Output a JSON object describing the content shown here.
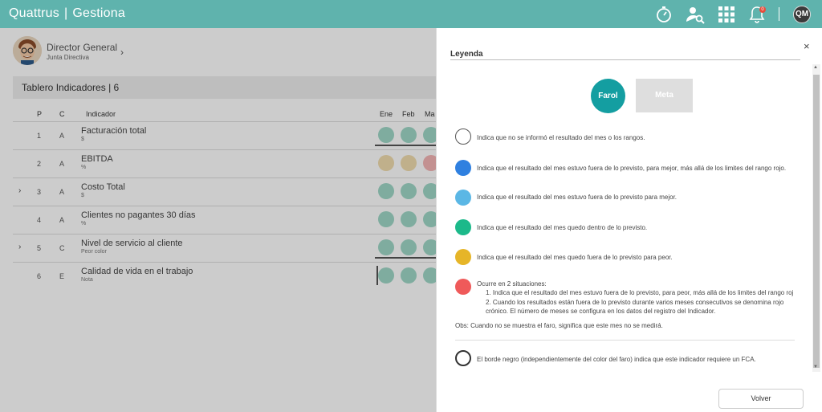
{
  "app": {
    "brand_left": "Quattrus",
    "brand_sep": "|",
    "brand_right": "Gestiona",
    "user_initials": "QM",
    "notification_count": "0"
  },
  "profile": {
    "title": "Director General",
    "subtitle": "Junta Directiva"
  },
  "tablero": {
    "title": "Tablero Indicadores | 6"
  },
  "table": {
    "headers": {
      "p": "P",
      "c": "C",
      "indicador": "Indicador",
      "m1": "Ene",
      "m2": "Feb",
      "m3": "Ma"
    },
    "rows": [
      {
        "p": "1",
        "c": "A",
        "name": "Facturación total",
        "unit": "$",
        "colors": [
          "#9fd8c7",
          "#9fd8c7",
          "#9fd8c7"
        ]
      },
      {
        "p": "2",
        "c": "A",
        "name": "EBITDA",
        "unit": "%",
        "colors": [
          "#f0dcae",
          "#f0dcae",
          "#f4b6b6"
        ]
      },
      {
        "p": "3",
        "c": "A",
        "name": "Costo Total",
        "unit": "$",
        "colors": [
          "#9fd8c7",
          "#9fd8c7",
          "#9fd8c7"
        ]
      },
      {
        "p": "4",
        "c": "A",
        "name": "Clientes no pagantes 30 días",
        "unit": "%",
        "colors": [
          "#9fd8c7",
          "#9fd8c7",
          "#9fd8c7"
        ]
      },
      {
        "p": "5",
        "c": "C",
        "name": "Nivel de servicio al cliente",
        "unit": "Peor color",
        "colors": [
          "#9fd8c7",
          "#9fd8c7",
          "#9fd8c7"
        ]
      },
      {
        "p": "6",
        "c": "E",
        "name": "Calidad de vida en el trabajo",
        "unit": "Nota",
        "colors": [
          "#9fd8c7",
          "#9fd8c7",
          "#9fd8c7"
        ]
      }
    ]
  },
  "panel": {
    "title": "Leyenda",
    "close": "×",
    "tab_farol": "Farol",
    "tab_meta": "Meta",
    "legend": [
      {
        "color": "#ffffff",
        "text": "Indica que no se informó el resultado del mes o los rangos."
      },
      {
        "color": "#2f80e0",
        "text": "Indica que el resultado del mes estuvo fuera de lo previsto, para mejor, más allá de los limites del rango rojo."
      },
      {
        "color": "#5bb7e5",
        "text": "Indica que el resultado del mes estuvo fuera de lo previsto para mejor."
      },
      {
        "color": "#1cb98a",
        "text": "Indica que el resultado del mes quedo dentro de lo previsto."
      },
      {
        "color": "#e6b528",
        "text": "Indica que el resultado del mes quedo fuera de lo previsto para peor."
      },
      {
        "color": "#ef5a5a",
        "text": "Ocurre en 2 situaciones:"
      }
    ],
    "situations": [
      "1. Indica que el resultado del mes estuvo fuera de lo previsto, para peor, más allá de los limites del rango roj",
      "2. Cuando los resultados están fuera de lo previsto durante varios meses consecutivos se denomina rojo crónico. El número de meses se configura en los datos del registro del Indicador."
    ],
    "obs": "Obs: Cuando no se muestra el faro, significa que este mes no se medirá.",
    "border_note": "El borde negro (independientemente del color del faro) indica que este indicador requiere un FCA.",
    "back_button": "Volver"
  }
}
